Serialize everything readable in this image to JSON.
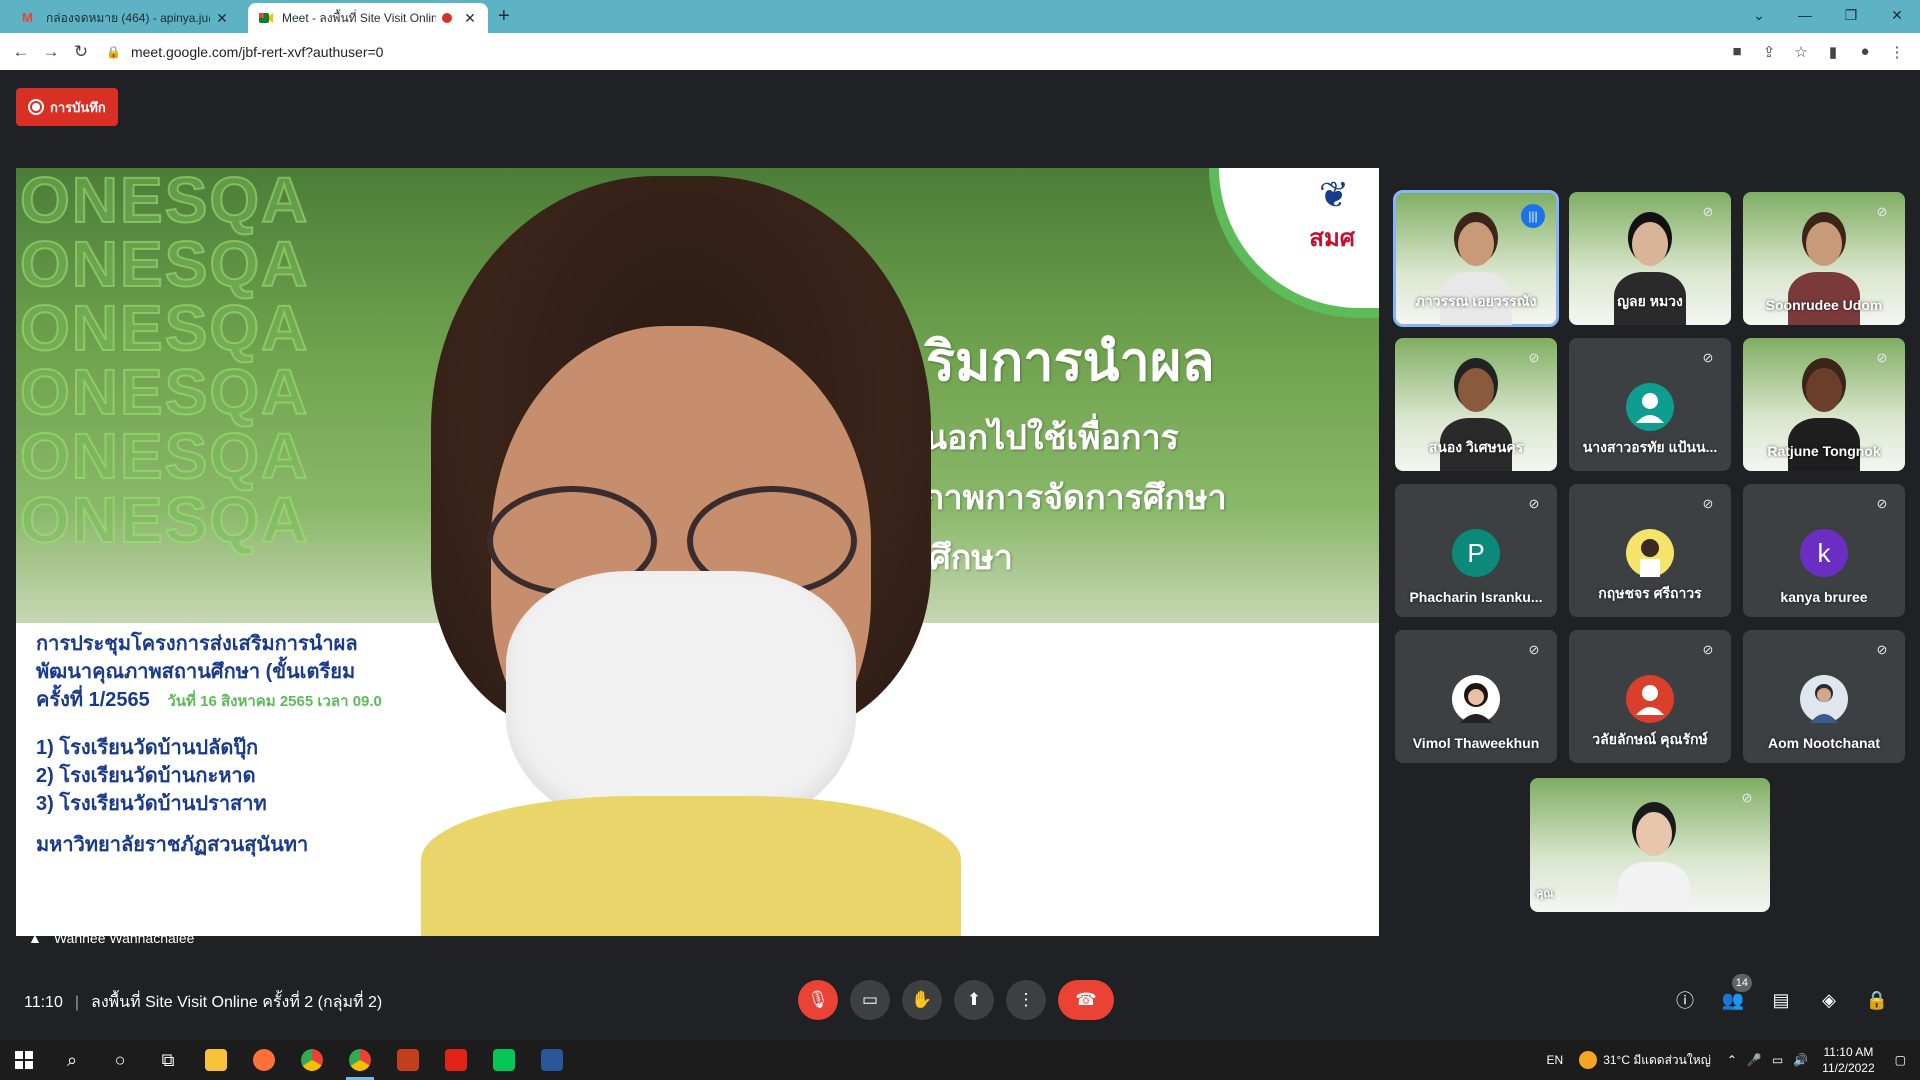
{
  "browser": {
    "tabs": [
      {
        "label": "กล่องจดหมาย (464) - apinya.ju@s",
        "favicon": "gmail-icon"
      },
      {
        "label": "Meet - ลงพื้นที่ Site Visit Onlin",
        "favicon": "meet-icon",
        "recording": true
      }
    ],
    "new_tab": "+",
    "url": "meet.google.com/jbf-rert-xvf?authuser=0",
    "window_controls": {
      "minimize": "—",
      "restore": "❐",
      "close": "✕",
      "tabs_menu": "⌄"
    }
  },
  "meet": {
    "recording_label": "การบันทึก",
    "main_video": {
      "speaker": "Wanhee Wannachalee",
      "slide": {
        "watermark": "ONESQA",
        "logo_text": "สมศ",
        "title_lines": [
          "ริมการนำผล",
          "ยนอกไปใช้เพื่อการ",
          "นภาพการจัดการศึกษา",
          "นศึกษา"
        ],
        "body_lines": [
          "การประชุมโครงการส่งเสริมการนำผล",
          "พัฒนาคุณภาพสถานศึกษา (ขั้นเตรียม",
          "ครั้งที่ 1/2565"
        ],
        "date_line": "วันที่ 16 สิงหาคม 2565 เวลา 09.0",
        "items": [
          "1)  โรงเรียนวัดบ้านปลัดปุ๊ก",
          "2)  โรงเรียนวัดบ้านกะหาด",
          "3)  โรงเรียนวัดบ้านปราสาท"
        ],
        "university": "มหาวิทยาลัยราชภัฏสวนสุนันทา"
      }
    },
    "participants": [
      {
        "name": "ภาวรรณ เอยวรรณัง",
        "type": "video",
        "speaking": true
      },
      {
        "name": "ญลย หมวง",
        "type": "video"
      },
      {
        "name": "Soonrudee Udom",
        "type": "video"
      },
      {
        "name": "สนอง วิเศษนคร",
        "type": "video"
      },
      {
        "name": "นางสาวอรทัย แป้นน...",
        "type": "avatar",
        "avatar_color": "#0f9d8f",
        "avatar_letter": ""
      },
      {
        "name": "Ratjune Tongnok",
        "type": "video"
      },
      {
        "name": "Phacharin Isranku...",
        "type": "avatar",
        "avatar_color": "#0b8a7a",
        "avatar_letter": "P"
      },
      {
        "name": "กฤษชจร ศรีถาวร",
        "type": "photo"
      },
      {
        "name": "kanya bruree",
        "type": "avatar",
        "avatar_color": "#6a2fc2",
        "avatar_letter": "k"
      },
      {
        "name": "Vimol Thaweekhun",
        "type": "photo"
      },
      {
        "name": "วลัยลักษณ์ คุณรักษ์",
        "type": "avatar-person",
        "avatar_color": "#d93f2a"
      },
      {
        "name": "Aom Nootchanat",
        "type": "photo"
      }
    ],
    "self_view_label": "คุณ",
    "meeting_time": "11:10",
    "meeting_title": "ลงพื้นที่ Site Visit Online ครั้งที่ 2 (กลุ่มที่ 2)",
    "participant_count": "14"
  },
  "taskbar": {
    "lang": "EN",
    "weather": "31°C  มีแดดส่วนใหญ่",
    "time": "11:10 AM",
    "date": "11/2/2022"
  }
}
